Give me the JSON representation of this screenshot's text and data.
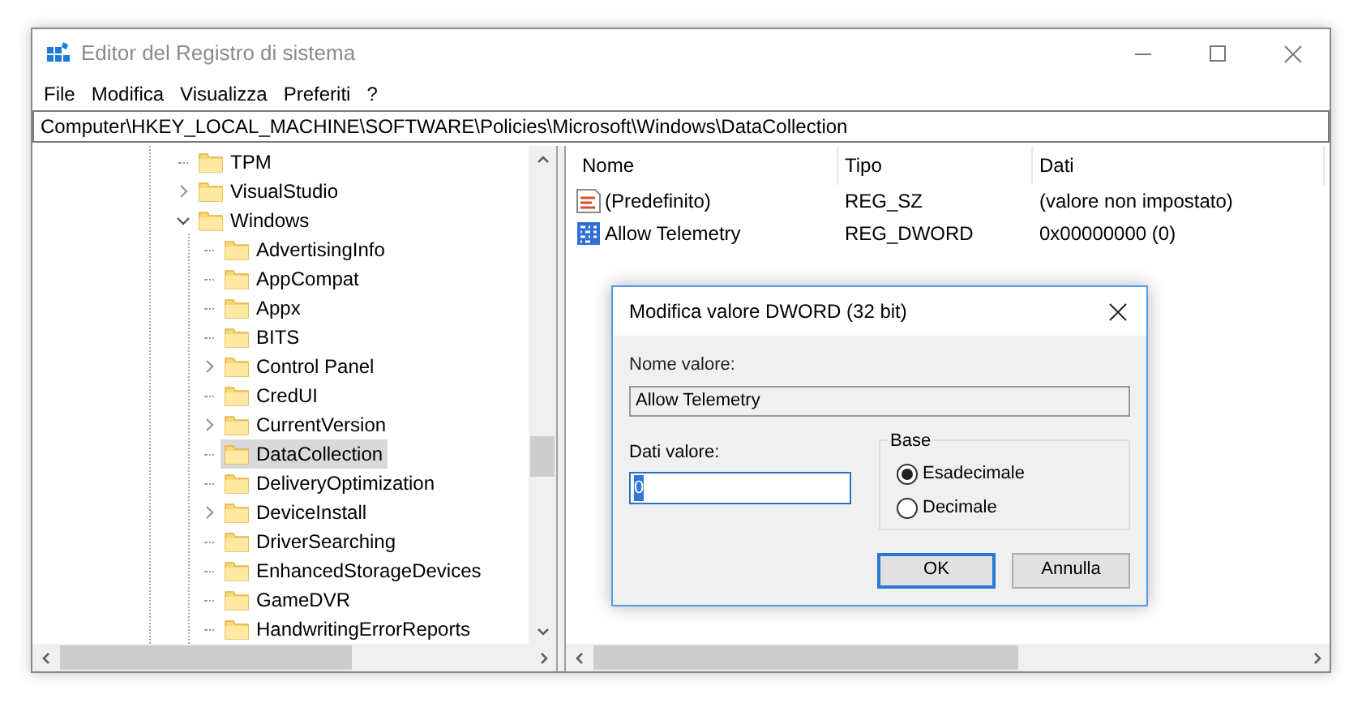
{
  "window": {
    "title": "Editor del Registro di sistema"
  },
  "menu": [
    "File",
    "Modifica",
    "Visualizza",
    "Preferiti",
    "?"
  ],
  "address": "Computer\\HKEY_LOCAL_MACHINE\\SOFTWARE\\Policies\\Microsoft\\Windows\\DataCollection",
  "tree": [
    {
      "label": "TPM",
      "kind": "leaf",
      "selected": false
    },
    {
      "label": "VisualStudio",
      "kind": "branch",
      "expanded": false,
      "selected": false
    },
    {
      "label": "Windows",
      "kind": "branch",
      "expanded": true,
      "selected": false,
      "children": [
        {
          "label": "AdvertisingInfo",
          "kind": "leaf",
          "selected": false
        },
        {
          "label": "AppCompat",
          "kind": "leaf",
          "selected": false
        },
        {
          "label": "Appx",
          "kind": "leaf",
          "selected": false
        },
        {
          "label": "BITS",
          "kind": "leaf",
          "selected": false
        },
        {
          "label": "Control Panel",
          "kind": "branch",
          "expanded": false,
          "selected": false
        },
        {
          "label": "CredUI",
          "kind": "leaf",
          "selected": false
        },
        {
          "label": "CurrentVersion",
          "kind": "branch",
          "expanded": false,
          "selected": false
        },
        {
          "label": "DataCollection",
          "kind": "leaf",
          "selected": true
        },
        {
          "label": "DeliveryOptimization",
          "kind": "leaf",
          "selected": false
        },
        {
          "label": "DeviceInstall",
          "kind": "branch",
          "expanded": false,
          "selected": false
        },
        {
          "label": "DriverSearching",
          "kind": "leaf",
          "selected": false
        },
        {
          "label": "EnhancedStorageDevices",
          "kind": "leaf",
          "selected": false
        },
        {
          "label": "GameDVR",
          "kind": "leaf",
          "selected": false
        },
        {
          "label": "HandwritingErrorReports",
          "kind": "leaf",
          "selected": false
        }
      ]
    }
  ],
  "list": {
    "columns": [
      "Nome",
      "Tipo",
      "Dati"
    ],
    "rows": [
      {
        "kind": "string",
        "name": "(Predefinito)",
        "type": "REG_SZ",
        "data": "(valore non impostato)"
      },
      {
        "kind": "binary",
        "name": "Allow Telemetry",
        "type": "REG_DWORD",
        "data": "0x00000000 (0)"
      }
    ]
  },
  "dialog": {
    "title": "Modifica valore DWORD (32 bit)",
    "name_label": "Nome valore:",
    "name_value": "Allow Telemetry",
    "data_label": "Dati valore:",
    "data_value": "0",
    "base_label": "Base",
    "radios": [
      {
        "label": "Esadecimale",
        "selected": true
      },
      {
        "label": "Decimale",
        "selected": false
      }
    ],
    "buttons": [
      {
        "label": "OK",
        "default": true
      },
      {
        "label": "Annulla",
        "default": false
      }
    ]
  }
}
